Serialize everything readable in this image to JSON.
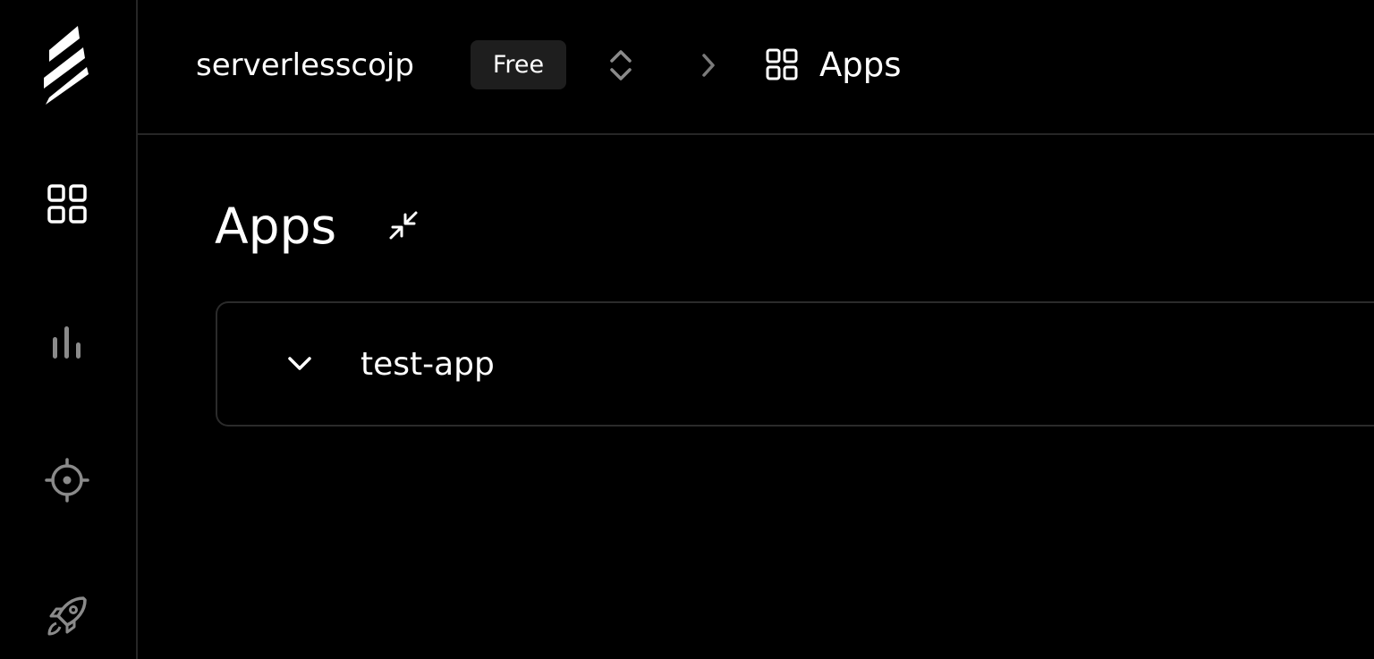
{
  "header": {
    "org_name": "serverlesscojp",
    "plan_badge": "Free",
    "breadcrumb_label": "Apps"
  },
  "sidebar": {
    "items": [
      {
        "name": "logo",
        "icon": "serverless-logo-icon"
      },
      {
        "name": "apps",
        "icon": "grid-icon",
        "active": true
      },
      {
        "name": "metrics",
        "icon": "bar-chart-icon"
      },
      {
        "name": "trace",
        "icon": "crosshair-icon"
      },
      {
        "name": "deploy",
        "icon": "rocket-icon"
      }
    ]
  },
  "main": {
    "title": "Apps",
    "apps": [
      {
        "name": "test-app",
        "expanded": false
      }
    ]
  },
  "colors": {
    "background": "#000000",
    "border": "#262626",
    "badge_bg": "#1e1e1e",
    "text_primary": "#ffffff",
    "icon_muted": "#8a8a8a"
  }
}
